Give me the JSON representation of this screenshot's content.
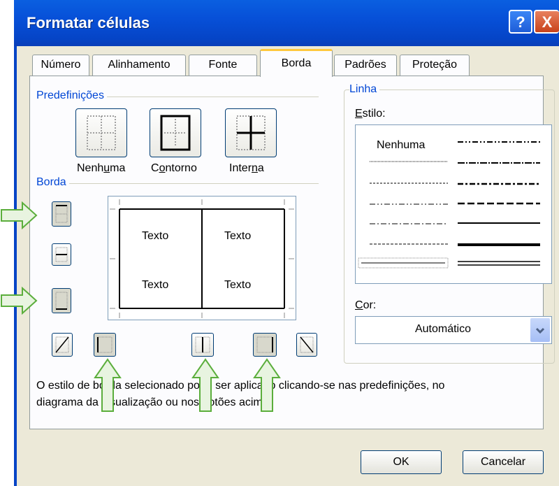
{
  "window": {
    "title": "Formatar células",
    "help_label": "?",
    "close_label": "X"
  },
  "tabs": [
    {
      "label": "Número"
    },
    {
      "label": "Alinhamento"
    },
    {
      "label": "Fonte"
    },
    {
      "label": "Borda",
      "active": true
    },
    {
      "label": "Padrões"
    },
    {
      "label": "Proteção"
    }
  ],
  "presets": {
    "group_label": "Predefinições",
    "items": [
      {
        "label_pre": "Nenh",
        "label_key": "u",
        "label_post": "ma",
        "icon": "no-border-icon"
      },
      {
        "label_pre": "C",
        "label_key": "o",
        "label_post": "ntorno",
        "icon": "outline-border-icon"
      },
      {
        "label_pre": "Inter",
        "label_key": "n",
        "label_post": "a",
        "icon": "inside-border-icon"
      }
    ]
  },
  "border": {
    "group_label": "Borda",
    "preview_texts": [
      "Texto",
      "Texto",
      "Texto",
      "Texto"
    ],
    "buttons": [
      {
        "name": "top-border-button",
        "icon": "top-border-icon",
        "pressed": true
      },
      {
        "name": "inside-horizontal-border-button",
        "icon": "inside-horizontal-icon",
        "pressed": false
      },
      {
        "name": "bottom-border-button",
        "icon": "bottom-border-icon",
        "pressed": true
      },
      {
        "name": "diagonal-up-border-button",
        "icon": "diagonal-up-icon",
        "pressed": false
      },
      {
        "name": "left-border-button",
        "icon": "left-border-icon",
        "pressed": true
      },
      {
        "name": "inside-vertical-border-button",
        "icon": "inside-vertical-icon",
        "pressed": false
      },
      {
        "name": "right-border-button",
        "icon": "right-border-icon",
        "pressed": true
      },
      {
        "name": "diagonal-down-border-button",
        "icon": "diagonal-down-icon",
        "pressed": false
      }
    ]
  },
  "line": {
    "group_label": "Linha",
    "style_label_key": "E",
    "style_label_rest": "stilo:",
    "none_label": "Nenhuma",
    "color_label_key": "C",
    "color_label_rest": "or:",
    "color_value": "Automático"
  },
  "hint_line1": "O estilo de borda selecionado pode ser aplicado clicando-se nas predefinições, no",
  "hint_line2": "diagrama da visualização ou nos botões acima.",
  "ok_label": "OK",
  "cancel_label": "Cancelar",
  "annotation_arrow_color": "#5BAE3C"
}
